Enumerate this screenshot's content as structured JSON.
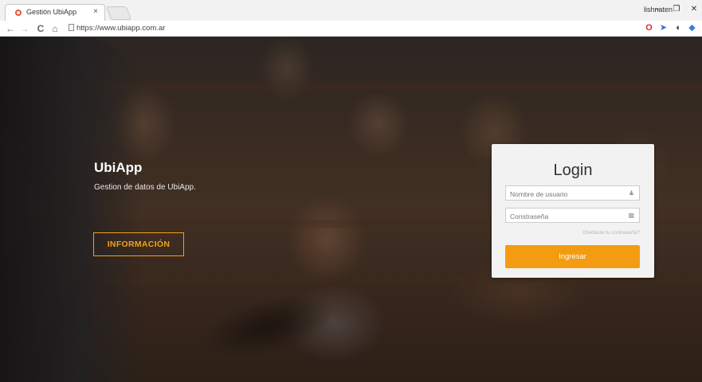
{
  "browser": {
    "tab_title": "Gestión UbiApp",
    "tab_close": "×",
    "profile_name": "lishnaten",
    "url": "https://www.ubiapp.com.ar",
    "window": {
      "minimize": "–",
      "restore": "❐",
      "close": "✕"
    },
    "nav": {
      "back": "←",
      "forward": "→",
      "reload": "C",
      "home": "⌂"
    }
  },
  "hero": {
    "title": "UbiApp",
    "subtitle": "Gestion de datos de UbiApp.",
    "info_button": "INFORMACIÓN",
    "accent_color": "#f0a11c"
  },
  "login": {
    "title": "Login",
    "username_placeholder": "Nombre de usuario",
    "password_placeholder": "Constraseña",
    "forgot": "Olvidaste tu contraseña?",
    "submit": "Ingresar",
    "button_color": "#f39c12"
  }
}
